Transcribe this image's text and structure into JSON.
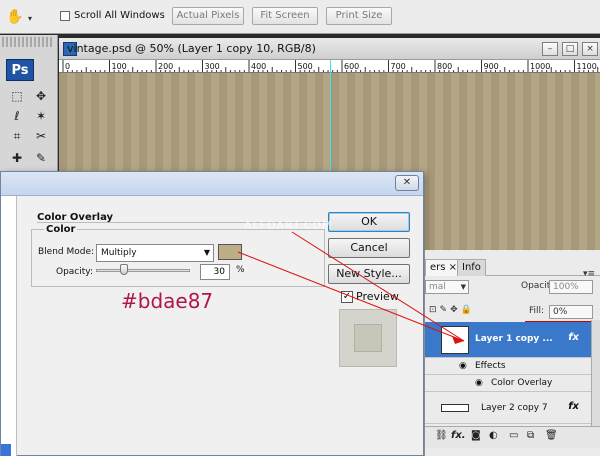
{
  "options_bar": {
    "scroll_all_windows": "Scroll All Windows",
    "actual_pixels": "Actual Pixels",
    "fit_screen": "Fit Screen",
    "print_size": "Print Size"
  },
  "tools": {
    "logo": "Ps"
  },
  "document": {
    "title": "vintage.psd @ 50% (Layer 1 copy 10, RGB/8)",
    "ruler_ticks": [
      "0",
      "100",
      "200",
      "300",
      "400",
      "500",
      "600",
      "700",
      "800",
      "900",
      "1000",
      "1100"
    ]
  },
  "dialog": {
    "group_title": "Color Overlay",
    "sub_title": "Color",
    "blend_mode_label": "Blend Mode:",
    "blend_mode_value": "Multiply",
    "opacity_label": "Opacity:",
    "opacity_value": "30",
    "opacity_unit": "%",
    "opacity_fraction": 0.3,
    "swatch_color": "#bdae87",
    "hex_note": "#bdae87",
    "buttons": {
      "ok": "OK",
      "cancel": "Cancel",
      "new_style": "New Style..."
    },
    "preview_label": "Preview",
    "preview_checked": "✓"
  },
  "watermark": "ALFOART.COM",
  "layers_panel": {
    "tabs": {
      "layers_partial": "ers",
      "close": "×",
      "info": "Info"
    },
    "blend_partial": "mal",
    "opacity_label": "Opacity:",
    "opacity_value": "100%",
    "fill_label": "Fill:",
    "fill_value": "0%",
    "rows": {
      "selected_name": "Layer 1 copy ...",
      "fx": "fx",
      "effects": "Effects",
      "color_overlay": "Color Overlay",
      "layer2_name": "Layer 2 copy 7",
      "layer2_fx": "fx"
    }
  },
  "colors": {
    "accent": "#3a78c9",
    "annotation": "#b0154e",
    "arrow": "#dd1111"
  }
}
